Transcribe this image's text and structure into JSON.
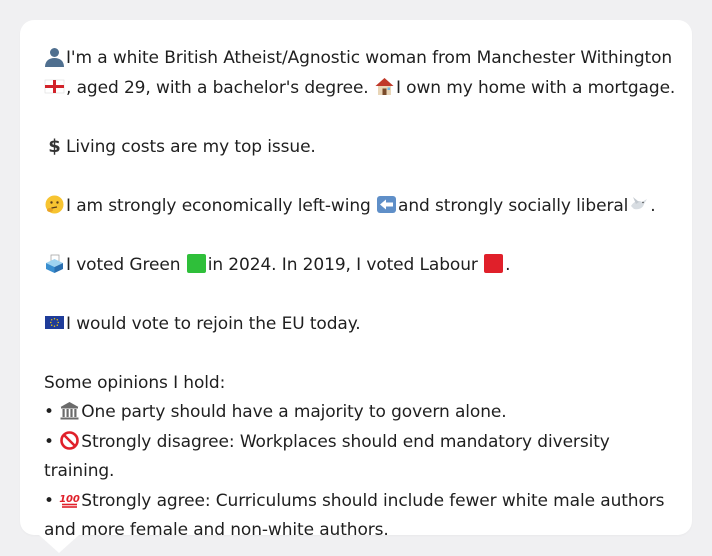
{
  "profile": {
    "intro_part1": "I'm a white British Atheist/Agnostic woman from Manchester Withington",
    "intro_part2": ", aged 29, with a bachelor's degree.",
    "intro_part3": "I own my home with a mortgage.",
    "top_issue": "Living costs are my top issue.",
    "ideology_part1": "I am strongly economically left-wing",
    "ideology_part2": "and strongly socially liberal",
    "ideology_part3": ".",
    "vote_part1": "I voted Green",
    "vote_part2": "in 2024. In 2019, I voted Labour",
    "vote_part3": ".",
    "eu": "I would vote to rejoin the EU today.",
    "opinions_heading": "Some opinions I hold:",
    "opinions": [
      {
        "bullet": "•",
        "icon": "classical-building-icon",
        "text": "One party should have a majority to govern alone."
      },
      {
        "bullet": "•",
        "icon": "prohibited-icon",
        "text": "Strongly disagree: Workplaces should end mandatory diversity training."
      },
      {
        "bullet": "•",
        "icon": "hundred-points-icon",
        "text": "Strongly agree: Curriculums should include fewer white male authors and more female and non-white authors."
      }
    ]
  },
  "icons": {
    "person": "person-silhouette-icon",
    "flag": "england-flag-icon",
    "home": "house-icon",
    "money": "dollar-sign-icon",
    "thinking": "thinking-face-icon",
    "left": "left-arrow-icon",
    "dove": "dove-icon",
    "ballot": "ballot-box-icon",
    "green": "green-square-icon",
    "red": "red-square-icon",
    "eu": "eu-flag-icon"
  },
  "colors": {
    "background": "#f0f0f2",
    "bubble": "#ffffff",
    "text": "#1f1f1f",
    "green_square": "#2fbf3a",
    "red_square": "#e0202a",
    "eu_blue": "#1f3c99"
  }
}
